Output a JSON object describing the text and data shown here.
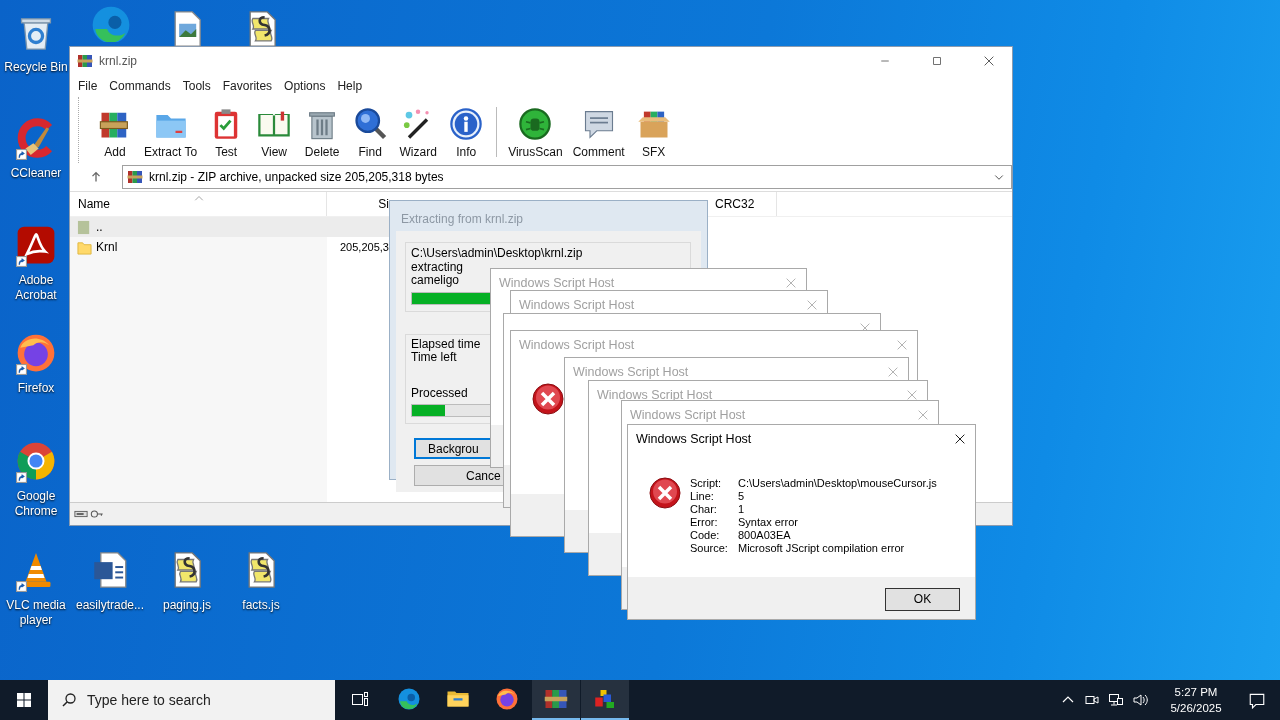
{
  "desktop_icons": [
    {
      "kind": "recycle",
      "label": "Recycle Bin"
    },
    {
      "kind": "edge"
    },
    {
      "kind": "image-file"
    },
    {
      "kind": "script-file"
    },
    {
      "kind": "ccleaner",
      "label": "CCleaner",
      "shortcut": true
    },
    {
      "kind": "acrobat",
      "label": "Adobe Acrobat",
      "shortcut": true
    },
    {
      "kind": "firefox",
      "label": "Firefox",
      "shortcut": true
    },
    {
      "kind": "chrome",
      "label": "Google Chrome",
      "shortcut": true
    },
    {
      "kind": "vlc",
      "label": "VLC media player",
      "shortcut": true
    },
    {
      "kind": "word-doc",
      "label": "easilytrade..."
    },
    {
      "kind": "script-file",
      "label": "paging.js"
    },
    {
      "kind": "script-file",
      "label": "facts.js"
    }
  ],
  "archive_window": {
    "title": "krnl.zip",
    "menu": [
      "File",
      "Commands",
      "Tools",
      "Favorites",
      "Options",
      "Help"
    ],
    "toolbar": [
      {
        "kind": "add",
        "label": "Add"
      },
      {
        "kind": "extract",
        "label": "Extract To"
      },
      {
        "kind": "test",
        "label": "Test"
      },
      {
        "kind": "view",
        "label": "View"
      },
      {
        "kind": "delete",
        "label": "Delete"
      },
      {
        "kind": "find",
        "label": "Find"
      },
      {
        "kind": "wizard",
        "label": "Wizard"
      },
      {
        "kind": "info",
        "label": "Info"
      },
      {
        "kind": "separator"
      },
      {
        "kind": "virusscan",
        "label": "VirusScan"
      },
      {
        "kind": "comment",
        "label": "Comment"
      },
      {
        "kind": "sfx",
        "label": "SFX"
      }
    ],
    "address": "krnl.zip - ZIP archive, unpacked size 205,205,318 bytes",
    "columns": [
      "Name",
      "Si",
      "CRC32"
    ],
    "rows": [
      {
        "kind": "parent",
        "name": "..",
        "selected": true
      },
      {
        "kind": "folder",
        "name": "Krnl",
        "size": "205,205,3",
        "selected": false
      }
    ]
  },
  "extract_dialog": {
    "title": "Extracting from krnl.zip",
    "lines": [
      "C:\\Users\\admin\\Desktop\\krnl.zip",
      "extracting",
      "cameligo"
    ],
    "progress": {
      "level": 0.45
    },
    "time_labels": [
      "Elapsed time",
      "Time left"
    ],
    "processed": {
      "label": "Processed",
      "level": 0.12
    },
    "buttons": [
      {
        "label": "Backgrou",
        "default": true
      },
      {
        "label": "Cance",
        "default": false
      }
    ]
  },
  "script_dialogs": [
    {
      "title": "Windows Script Host",
      "active": false
    },
    {
      "title": "Windows Script Host",
      "active": false
    },
    {
      "title": "Windows Script Host",
      "active": false,
      "error_icon": true
    },
    {
      "title": "Windows Script Host",
      "active": false
    },
    {
      "title": "Windows Script Host",
      "active": false
    },
    {
      "title": "Windows Script Host",
      "active": false
    },
    {
      "title": "Windows Script Host",
      "active": true,
      "error_icon": true,
      "details": [
        {
          "label": "Script:",
          "value": "C:\\Users\\admin\\Desktop\\mouseCursor.js"
        },
        {
          "label": "Line:",
          "value": "5"
        },
        {
          "label": "Char:",
          "value": "1"
        },
        {
          "label": "Error:",
          "value": "Syntax error"
        },
        {
          "label": "Code:",
          "value": "800A03EA"
        },
        {
          "label": "Source:",
          "value": "Microsoft JScript compilation error"
        }
      ],
      "button": "OK"
    }
  ],
  "taskbar": {
    "search": {
      "placeholder": "Type here to search"
    },
    "apps": [
      {
        "kind": "task-view",
        "active": false
      },
      {
        "kind": "edge",
        "active": false
      },
      {
        "kind": "explorer",
        "active": false
      },
      {
        "kind": "firefox",
        "active": false
      },
      {
        "kind": "winrar",
        "active": true
      },
      {
        "kind": "wsh",
        "active": true
      }
    ],
    "tray": [
      {
        "kind": "caret-up"
      },
      {
        "kind": "video"
      },
      {
        "kind": "network"
      },
      {
        "kind": "speaker"
      }
    ],
    "time": "5:27 PM",
    "date": "5/26/2025"
  }
}
